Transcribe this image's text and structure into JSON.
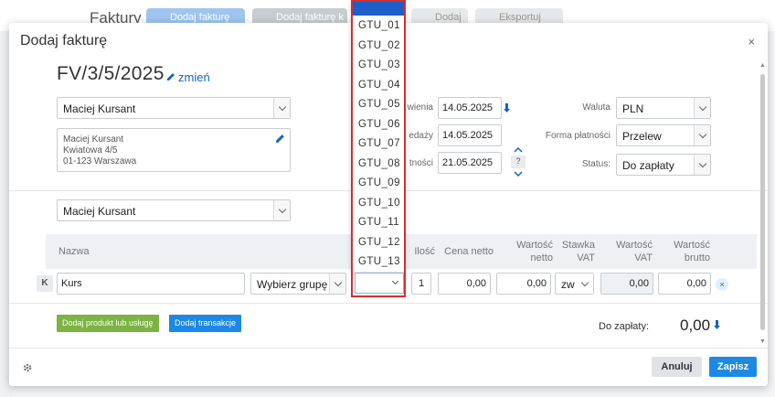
{
  "background": {
    "title": "Faktury",
    "buttons": [
      "Dodaj fakturę",
      "Dodaj fakturę k",
      "Dodaj",
      "Eksportuj"
    ]
  },
  "modal": {
    "title": "Dodaj fakturę",
    "close_icon": "×",
    "invoice_number": "FV/3/5/2025",
    "change_link": "zmień",
    "buyer_select": "Maciej Kursant",
    "address_lines": [
      "Maciej Kursant",
      "Kwiatowa 4/5",
      "01-123 Warszawa"
    ],
    "recipient_select": "Maciej Kursant"
  },
  "dates": {
    "issue_label": "wienia",
    "issue_value": "14.05.2025",
    "sale_label": "edaży",
    "sale_value": "14.05.2025",
    "payment_label": "tności",
    "payment_value": "21.05.2025",
    "help_label": "?"
  },
  "right_fields": {
    "currency_label": "Waluta",
    "currency_value": "PLN",
    "payment_form_label": "Forma płatności",
    "payment_form_value": "Przelew",
    "status_label": "Status:",
    "status_value": "Do zapłaty"
  },
  "table": {
    "headers": {
      "name": "Nazwa",
      "qty": "Ilość",
      "net_price": "Cena netto",
      "net_value_1": "Wartość",
      "net_value_2": "netto",
      "vat_rate_1": "Stawka",
      "vat_rate_2": "VAT",
      "vat_value_1": "Wartość",
      "vat_value_2": "VAT",
      "gross_value_1": "Wartość",
      "gross_value_2": "brutto"
    },
    "row": {
      "badge": "K",
      "name": "Kurs",
      "group_select": "Wybierz grupę",
      "qty": "1",
      "net_price": "0,00",
      "net_value": "0,00",
      "vat_rate": "zw",
      "vat_value": "0,00",
      "gross_value": "0,00",
      "remove": "×"
    }
  },
  "actions": {
    "add_product": "Dodaj produkt lub usługę",
    "add_transaction": "Dodaj transakcje",
    "due_label": "Do zapłaty:",
    "due_value": "0,00"
  },
  "footer": {
    "cancel": "Anuluj",
    "save": "Zapisz"
  },
  "gtu_dropdown": {
    "options": [
      "GTU_01",
      "GTU_02",
      "GTU_03",
      "GTU_04",
      "GTU_05",
      "GTU_06",
      "GTU_07",
      "GTU_08",
      "GTU_09",
      "GTU_10",
      "GTU_11",
      "GTU_12",
      "GTU_13"
    ],
    "selected_index": -1,
    "highlight_color": "#1e5ec8",
    "outline_color": "#d32f2f"
  },
  "colors": {
    "accent": "#1e88e5",
    "green": "#7cb342"
  }
}
